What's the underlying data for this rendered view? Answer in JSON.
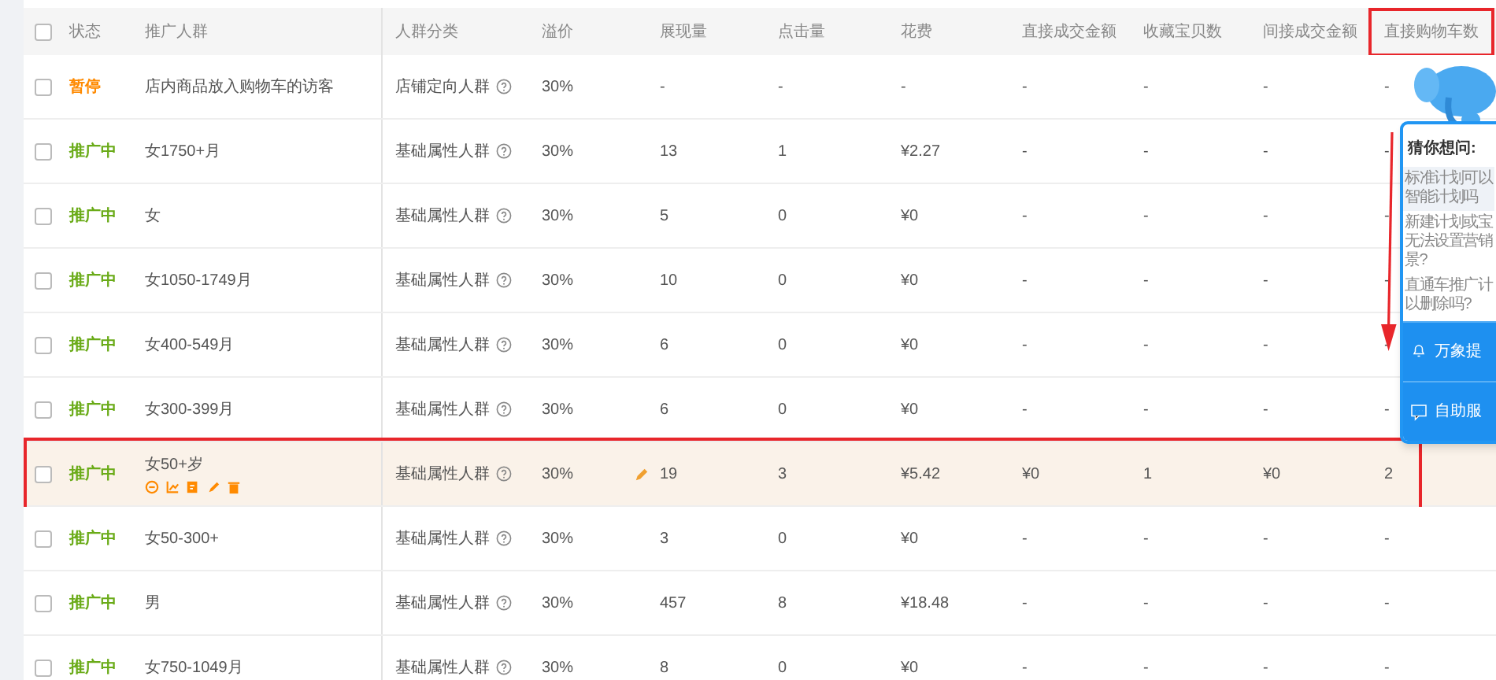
{
  "table": {
    "columns": [
      {
        "label": "状态",
        "marked": false
      },
      {
        "label": "推广人群",
        "marked": false
      },
      {
        "label": "人群分类",
        "marked": false
      },
      {
        "label": "溢价",
        "marked": false
      },
      {
        "label": "展现量",
        "marked": false
      },
      {
        "label": "点击量",
        "marked": false
      },
      {
        "label": "花费",
        "marked": false
      },
      {
        "label": "直接成交金额",
        "marked": false
      },
      {
        "label": "收藏宝贝数",
        "marked": false
      },
      {
        "label": "间接成交金额",
        "marked": false
      },
      {
        "label": "直接购物车数",
        "marked": true
      }
    ],
    "select_all": {
      "checked": false
    },
    "rows": [
      {
        "checked": false,
        "kind": "paused",
        "cells": [
          "暂停",
          "店内商品放入购物车的访客",
          "店铺定向人群",
          "30%",
          "-",
          "-",
          "-",
          "-",
          "-",
          "-",
          "-"
        ],
        "highlighted": false,
        "marked": false
      },
      {
        "checked": false,
        "kind": "active",
        "cells": [
          "推广中",
          "女1750+月",
          "基础属性人群",
          "30%",
          "13",
          "1",
          "¥2.27",
          "-",
          "-",
          "-",
          "-"
        ],
        "highlighted": false,
        "marked": false
      },
      {
        "checked": false,
        "kind": "active",
        "cells": [
          "推广中",
          "女",
          "基础属性人群",
          "30%",
          "5",
          "0",
          "¥0",
          "-",
          "-",
          "-",
          "-"
        ],
        "highlighted": false,
        "marked": false
      },
      {
        "checked": false,
        "kind": "active",
        "cells": [
          "推广中",
          "女1050-1749月",
          "基础属性人群",
          "30%",
          "10",
          "0",
          "¥0",
          "-",
          "-",
          "-",
          "-"
        ],
        "highlighted": false,
        "marked": false
      },
      {
        "checked": false,
        "kind": "active",
        "cells": [
          "推广中",
          "女400-549月",
          "基础属性人群",
          "30%",
          "6",
          "0",
          "¥0",
          "-",
          "-",
          "-",
          "-"
        ],
        "highlighted": false,
        "marked": false
      },
      {
        "checked": false,
        "kind": "active",
        "cells": [
          "推广中",
          "女300-399月",
          "基础属性人群",
          "30%",
          "6",
          "0",
          "¥0",
          "-",
          "-",
          "-",
          "-"
        ],
        "highlighted": false,
        "marked": false
      },
      {
        "checked": false,
        "kind": "active",
        "cells": [
          "推广中",
          "女50+岁",
          "基础属性人群",
          "30%",
          "19",
          "3",
          "¥5.42",
          "¥0",
          "1",
          "¥0",
          "2"
        ],
        "highlighted": true,
        "marked": true
      },
      {
        "checked": false,
        "kind": "active",
        "cells": [
          "推广中",
          "女50-300+",
          "基础属性人群",
          "30%",
          "3",
          "0",
          "¥0",
          "-",
          "-",
          "-",
          "-"
        ],
        "highlighted": false,
        "marked": false
      },
      {
        "checked": false,
        "kind": "active",
        "cells": [
          "推广中",
          "男",
          "基础属性人群",
          "30%",
          "457",
          "8",
          "¥18.48",
          "-",
          "-",
          "-",
          "-"
        ],
        "highlighted": false,
        "marked": false
      },
      {
        "checked": false,
        "kind": "active",
        "cells": [
          "推广中",
          "女750-1049月",
          "基础属性人群",
          "30%",
          "8",
          "0",
          "¥0",
          "-",
          "-",
          "-",
          "-"
        ],
        "highlighted": false,
        "marked": false
      }
    ]
  },
  "help_panel": {
    "title": "猜你想问:",
    "questions": [
      "标准计划可以智能计划吗",
      "新建计划或宝无法设置营销景?",
      "直通车推广计以删除吗?"
    ],
    "actions": [
      {
        "kind": "bell",
        "label": "万象提"
      },
      {
        "kind": "chat",
        "label": "自助服"
      }
    ]
  }
}
